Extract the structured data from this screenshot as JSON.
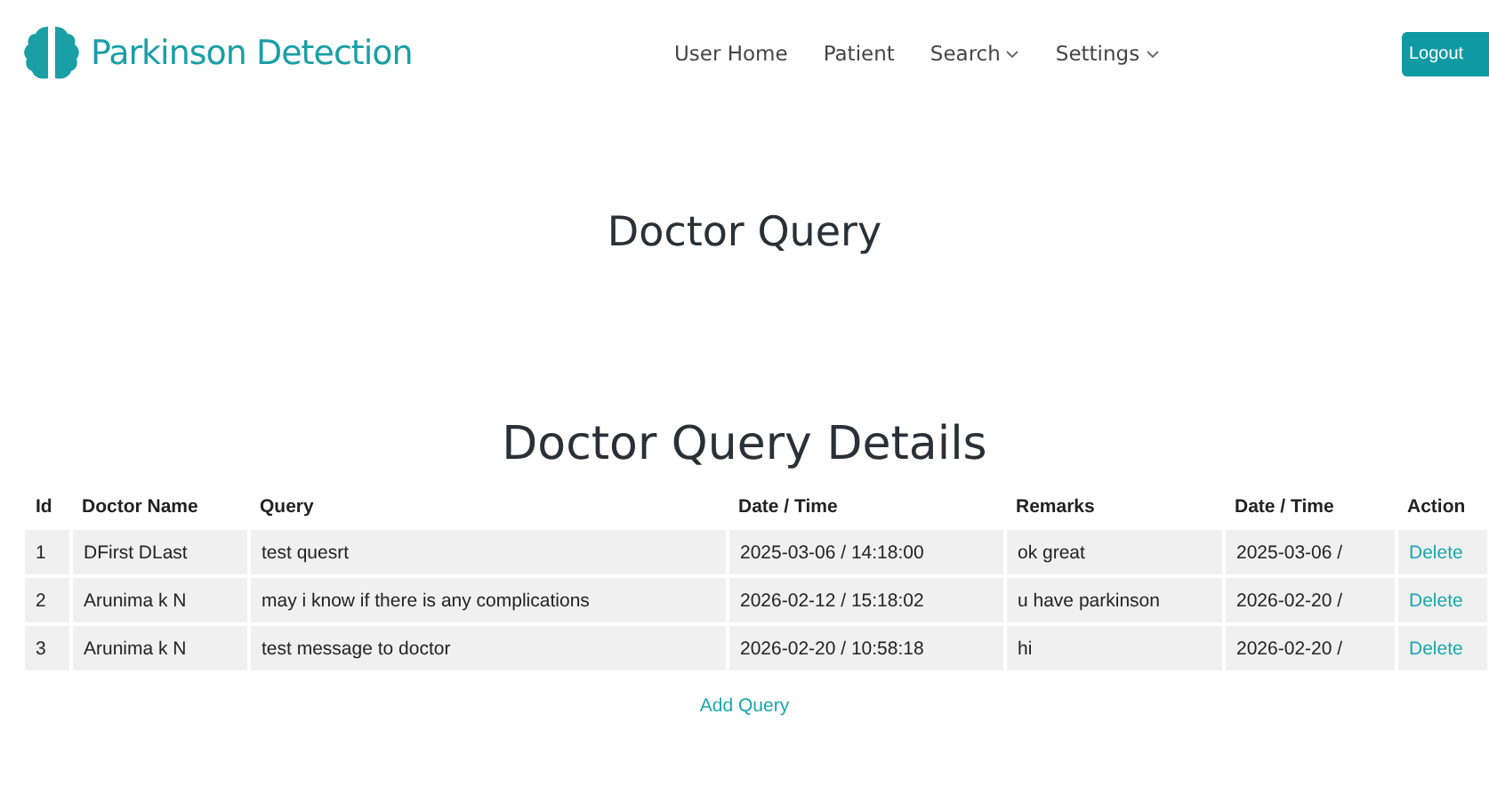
{
  "brand": {
    "name": "Parkinson Detection"
  },
  "nav": [
    {
      "label": "User Home",
      "dropdown": false
    },
    {
      "label": "Patient",
      "dropdown": false
    },
    {
      "label": "Search",
      "dropdown": true
    },
    {
      "label": "Settings",
      "dropdown": true
    }
  ],
  "logout": "Logout",
  "page_title": "Doctor Query",
  "section_title": "Doctor Query Details",
  "table": {
    "columns": [
      "Id",
      "Doctor Name",
      "Query",
      "Date / Time",
      "Remarks",
      "Date / Time",
      "Action"
    ],
    "rows": [
      {
        "cells": [
          "1",
          "DFirst DLast",
          "test quesrt",
          "2025-03-06 / 14:18:00",
          "ok great",
          "2025-03-06 /"
        ],
        "action": "Delete"
      },
      {
        "cells": [
          "2",
          "Arunima k N",
          "may i know if there is any complications",
          "2026-02-12 / 15:18:02",
          "u have parkinson",
          "2026-02-20 /"
        ],
        "action": "Delete"
      },
      {
        "cells": [
          "3",
          "Arunima k N",
          "test message to doctor",
          "2026-02-20 / 10:58:18",
          "hi",
          "2026-02-20 /"
        ],
        "action": "Delete"
      }
    ]
  },
  "add_link": "Add Query"
}
